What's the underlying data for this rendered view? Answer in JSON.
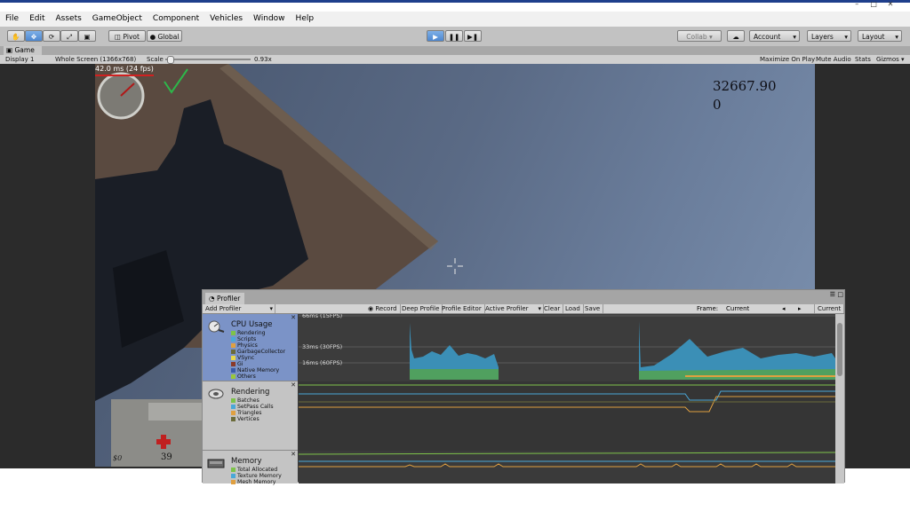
{
  "window_controls": [
    "–",
    "□",
    "✕"
  ],
  "menu": [
    "File",
    "Edit",
    "Assets",
    "GameObject",
    "Component",
    "Vehicles",
    "Window",
    "Help"
  ],
  "toolbar": {
    "pivot": "Pivot",
    "global": "Global",
    "collab": "Collab ▾",
    "account": "Account",
    "layers": "Layers",
    "layout": "Layout",
    "play_state": "playing"
  },
  "game_view": {
    "tab_label": "Game",
    "display": "Display 1",
    "resolution": "Whole Screen (1366x768)",
    "scale_label": "Scale",
    "scale_value": "0.93x",
    "scale_fraction": 0.05,
    "maximize": "Maximize On Play",
    "mute": "Mute Audio",
    "stats": "Stats",
    "gizmos": "Gizmos"
  },
  "hud": {
    "fps_text": "42.0 ms (24 fps)",
    "value_top": "32667.90",
    "value_bottom": "0",
    "money": "$0",
    "health": "39"
  },
  "profiler": {
    "tab_label": "Profiler",
    "add_profiler": "Add Profiler",
    "record": "Record",
    "deep_profile": "Deep Profile",
    "profile_editor": "Profile Editor",
    "active_profiler": "Active Profiler",
    "clear": "Clear",
    "load": "Load",
    "save": "Save",
    "frame_label": "Frame:",
    "frame_value": "Current",
    "current_button": "Current",
    "sections": [
      {
        "title": "CPU Usage",
        "items": [
          {
            "name": "Rendering",
            "color": "#7ec34a"
          },
          {
            "name": "Scripts",
            "color": "#4aa8d8"
          },
          {
            "name": "Physics",
            "color": "#e0a040"
          },
          {
            "name": "GarbageCollector",
            "color": "#6b6b3a"
          },
          {
            "name": "VSync",
            "color": "#e8d84a"
          },
          {
            "name": "Gi",
            "color": "#8a3a2a"
          },
          {
            "name": "Native Memory",
            "color": "#3a5aa8"
          },
          {
            "name": "Others",
            "color": "#9ac83a"
          }
        ]
      },
      {
        "title": "Rendering",
        "items": [
          {
            "name": "Batches",
            "color": "#7ec34a"
          },
          {
            "name": "SetPass Calls",
            "color": "#4aa8d8"
          },
          {
            "name": "Triangles",
            "color": "#e0a040"
          },
          {
            "name": "Vertices",
            "color": "#6b6b3a"
          }
        ]
      },
      {
        "title": "Memory",
        "items": [
          {
            "name": "Total Allocated",
            "color": "#7ec34a"
          },
          {
            "name": "Texture Memory",
            "color": "#4aa8d8"
          },
          {
            "name": "Mesh Memory",
            "color": "#e0a040"
          }
        ]
      }
    ],
    "cpu_ms_lines": [
      "66ms (15FPS)",
      "33ms (30FPS)",
      "16ms (60FPS)"
    ]
  },
  "colors": {
    "viewport_bg": "#5a6a85",
    "profiler_selected": "#7b93c7",
    "play_accent": "#4d86cf",
    "check": "#2db84a"
  }
}
